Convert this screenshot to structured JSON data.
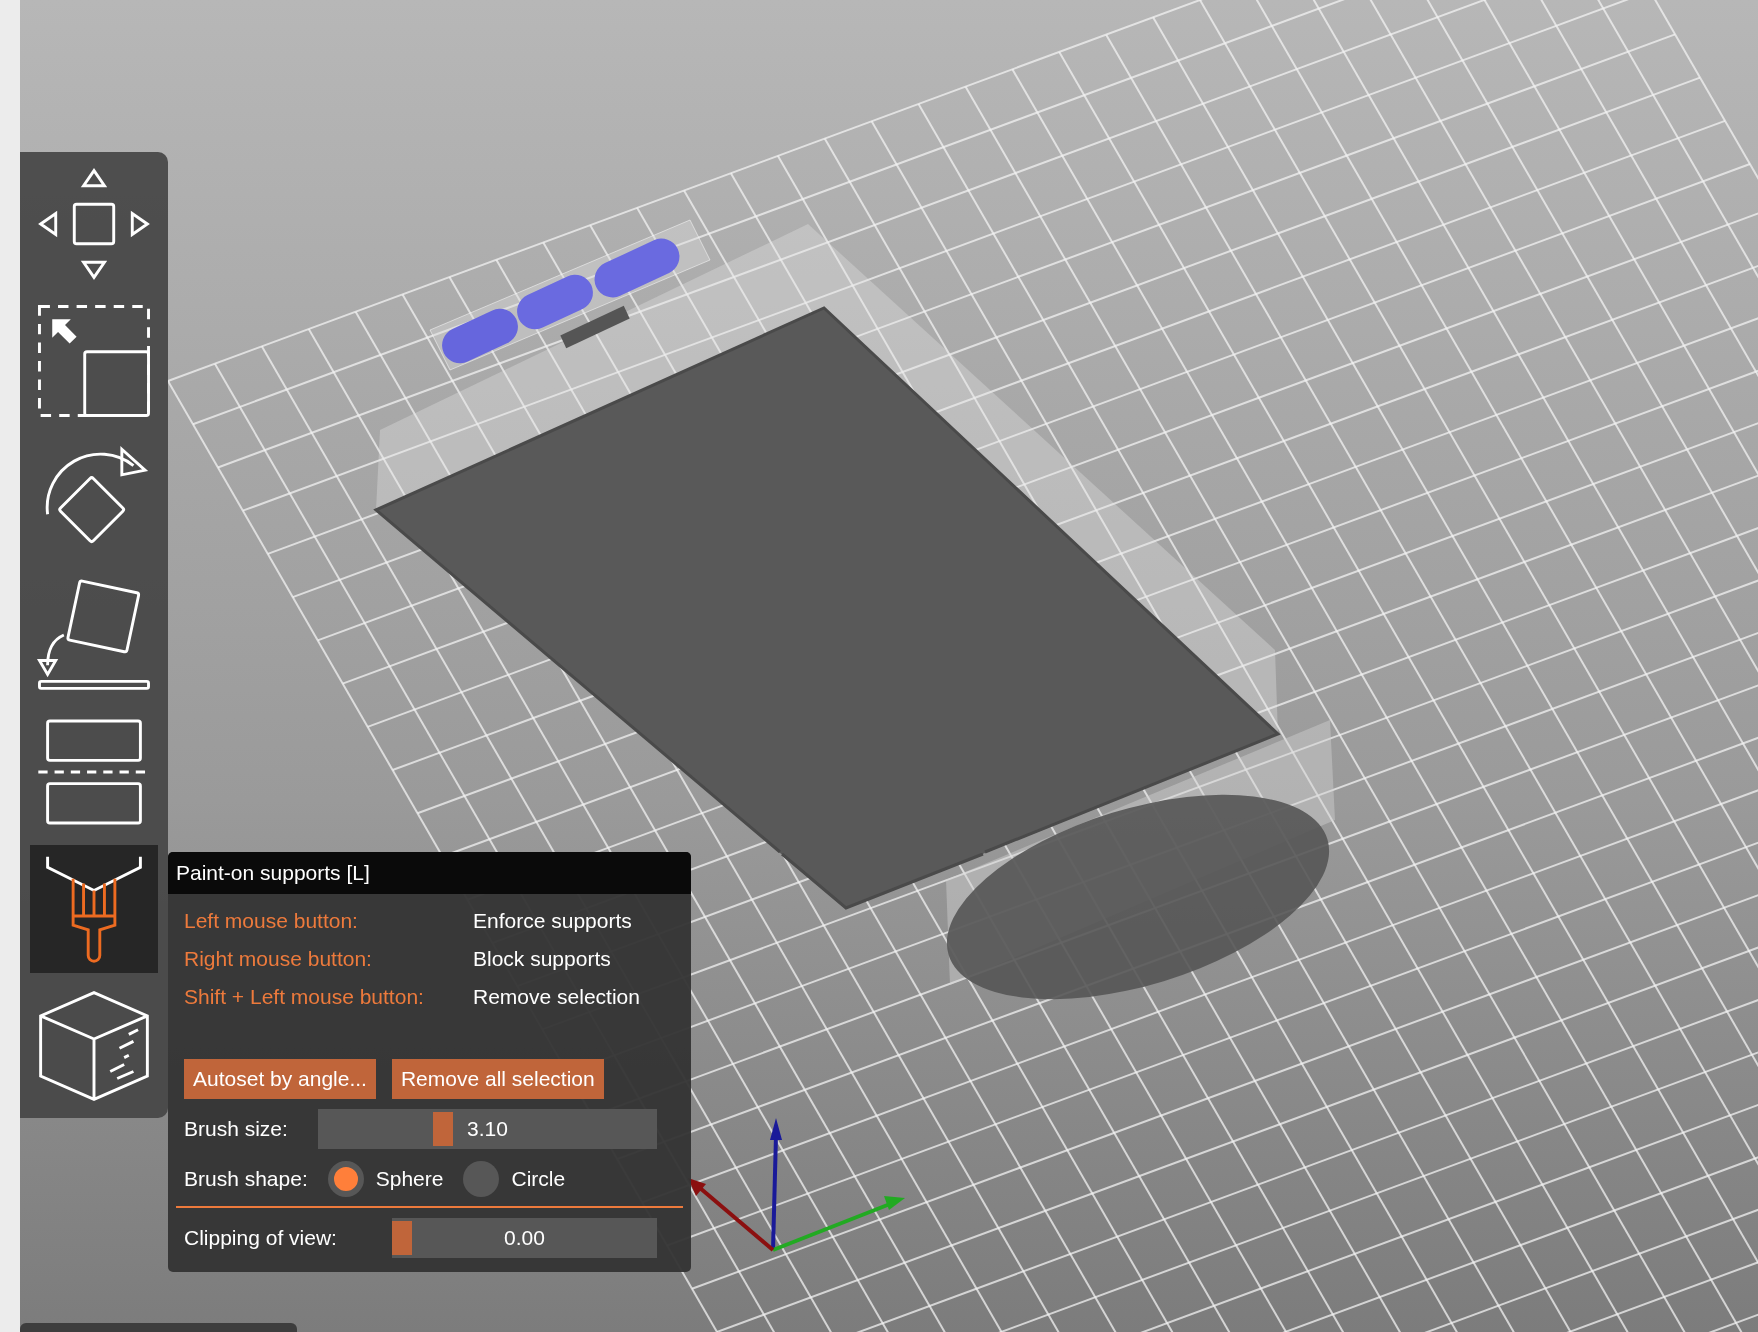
{
  "toolbar": {
    "tools": [
      {
        "kind": "move",
        "selected": false
      },
      {
        "kind": "scale",
        "selected": false
      },
      {
        "kind": "rotate",
        "selected": false
      },
      {
        "kind": "place",
        "selected": false
      },
      {
        "kind": "cut",
        "selected": false
      },
      {
        "kind": "paint",
        "selected": true
      },
      {
        "kind": "seam",
        "selected": false
      }
    ]
  },
  "panel": {
    "title": "Paint-on supports [L]",
    "help": [
      {
        "key": "Left mouse button:",
        "action": "Enforce supports"
      },
      {
        "key": "Right mouse button:",
        "action": "Block supports"
      },
      {
        "key": "Shift + Left mouse button:",
        "action": "Remove selection"
      }
    ],
    "buttons": [
      "Autoset by angle...",
      "Remove all selection"
    ],
    "brush_size": {
      "label": "Brush size:",
      "level": 0.36,
      "reading": "3.10"
    },
    "brush_shape": {
      "label": "Brush shape:",
      "options": [
        {
          "label": "Sphere",
          "selected": true
        },
        {
          "label": "Circle",
          "selected": false
        }
      ]
    },
    "clipping": {
      "label": "Clipping of view:",
      "level": 0,
      "reading": "0.00"
    }
  }
}
